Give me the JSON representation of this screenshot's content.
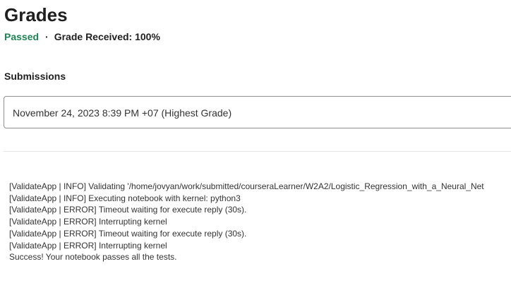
{
  "page": {
    "title": "Grades"
  },
  "grade": {
    "status": "Passed",
    "separator": "·",
    "received_label": "Grade Received: 100%"
  },
  "submissions": {
    "heading": "Submissions",
    "selected": "November 24, 2023 8:39 PM +07 (Highest Grade)"
  },
  "log": {
    "lines": [
      "[ValidateApp | INFO] Validating '/home/jovyan/work/submitted/courseraLearner/W2A2/Logistic_Regression_with_a_Neural_Net",
      "[ValidateApp | INFO] Executing notebook with kernel: python3",
      "[ValidateApp | ERROR] Timeout waiting for execute reply (30s).",
      "[ValidateApp | ERROR] Interrupting kernel",
      "[ValidateApp | ERROR] Timeout waiting for execute reply (30s).",
      "[ValidateApp | ERROR] Interrupting kernel",
      "Success! Your notebook passes all the tests."
    ]
  },
  "colors": {
    "passed": "#1f8354",
    "text": "#1f1f1f",
    "border": "#8f8f8f",
    "divider": "#e5e5e5"
  }
}
